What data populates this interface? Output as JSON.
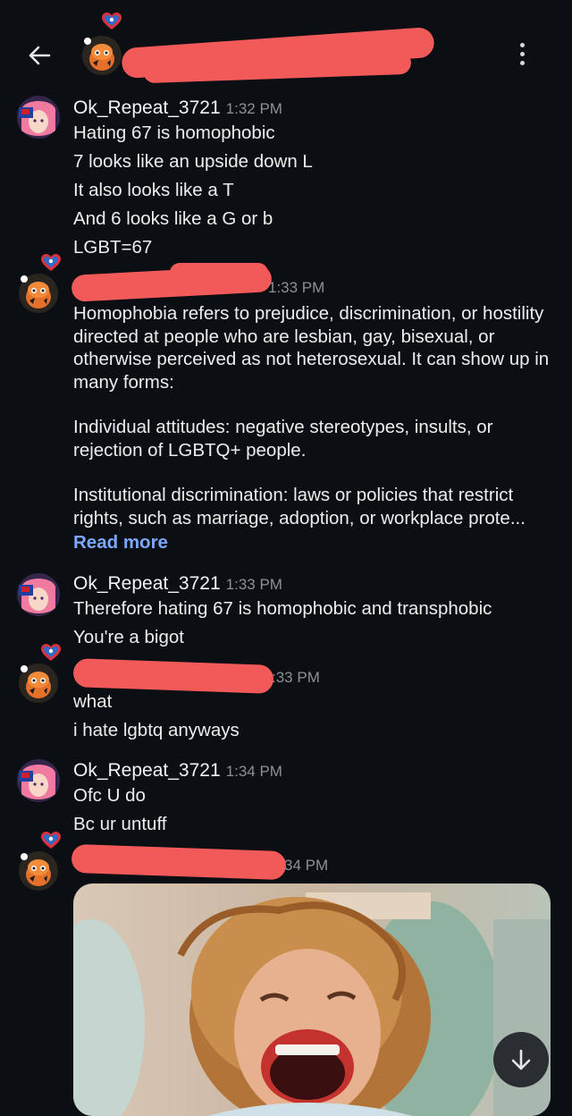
{
  "header": {
    "back_icon": "arrow-left-icon",
    "menu_icon": "more-vertical-icon"
  },
  "messages": [
    {
      "username": "Ok_Repeat_3721",
      "time": "1:32 PM",
      "lines": [
        "Hating 67 is homophobic",
        "7 looks like an upside down L",
        "It also looks like a T",
        "And 6 looks like a G or b",
        "LGBT=67"
      ]
    },
    {
      "time": "1:33 PM",
      "paragraphs": [
        "Homophobia refers to prejudice, discrimination, or hostility directed at people who are lesbian, gay, bisexual, or otherwise perceived as not heterosexual. It can show up in many forms:",
        "Individual attitudes: negative stereotypes, insults, or rejection of LGBTQ+ people.",
        "Institutional discrimination: laws or policies that restrict rights, such as marriage, adoption, or workplace prote..."
      ],
      "read_more": "Read more"
    },
    {
      "username": "Ok_Repeat_3721",
      "time": "1:33 PM",
      "lines": [
        "Therefore hating 67 is homophobic and transphobic",
        "You're a bigot"
      ]
    },
    {
      "time": ":33 PM",
      "lines": [
        "what",
        "i hate lgbtq anyways"
      ]
    },
    {
      "username": "Ok_Repeat_3721",
      "time": "1:34 PM",
      "lines": [
        "Ofc U do",
        "Bc ur untuff"
      ]
    },
    {
      "time": "34 PM",
      "attachment": "laughing-woman-gif"
    }
  ],
  "scroll_button_icon": "arrow-down-icon",
  "colors": {
    "background": "#0b0f13",
    "redaction": "#f25a5a",
    "link": "#7aa8ff",
    "timestamp": "#8d9196"
  }
}
